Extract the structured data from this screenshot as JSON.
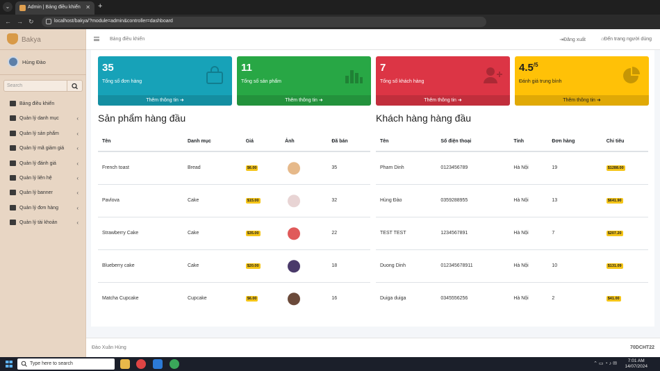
{
  "browser": {
    "tab_title": "Admin | Bảng điều khiển",
    "url": "localhost/bakya/?module=admin&controller=dashboard"
  },
  "sidebar": {
    "brand": "Bakya",
    "user_name": "Hùng Đào",
    "search_placeholder": "Search",
    "items": [
      {
        "label": "Bảng điều khiển",
        "icon": "dashboard-icon",
        "has_arrow": false
      },
      {
        "label": "Quản lý danh mục",
        "icon": "list-icon",
        "has_arrow": true
      },
      {
        "label": "Quản lý sản phẩm",
        "icon": "cake-icon",
        "has_arrow": true
      },
      {
        "label": "Quản lý mã giảm giá",
        "icon": "gift-icon",
        "has_arrow": true
      },
      {
        "label": "Quản lý đánh giá",
        "icon": "comment-icon",
        "has_arrow": true
      },
      {
        "label": "Quản lý liên hệ",
        "icon": "envelope-icon",
        "has_arrow": true
      },
      {
        "label": "Quản lý banner",
        "icon": "image-icon",
        "has_arrow": true
      },
      {
        "label": "Quản lý đơn hàng",
        "icon": "file-icon",
        "has_arrow": true
      },
      {
        "label": "Quản lý tài khoản",
        "icon": "user-icon",
        "has_arrow": true
      }
    ]
  },
  "topbar": {
    "breadcrumb": "Bảng điều khiển",
    "logout": "Đăng xuất",
    "to_user_page": "Đến trang người dùng"
  },
  "stats": [
    {
      "value": "35",
      "label": "Tổng số đơn hàng",
      "footer": "Thêm thông tin",
      "color": "#17a2b8",
      "icon": "shopping-bag-icon"
    },
    {
      "value": "11",
      "label": "Tổng số sản phẩm",
      "footer": "Thêm thông tin",
      "color": "#28a745",
      "icon": "bar-chart-icon"
    },
    {
      "value": "7",
      "label": "Tổng số khách hàng",
      "footer": "Thêm thông tin",
      "color": "#dc3545",
      "icon": "user-plus-icon"
    },
    {
      "value": "4.5",
      "suffix": "/5",
      "label": "Đánh giá trung bình",
      "footer": "Thêm thông tin",
      "color": "#ffc107",
      "icon": "pie-chart-icon"
    }
  ],
  "top_products": {
    "title": "Sản phẩm hàng đầu",
    "headers": [
      "Tên",
      "Danh mục",
      "Giá",
      "Ảnh",
      "Đã bán"
    ],
    "rows": [
      {
        "name": "French toast",
        "category": "Bread",
        "price": "$6.00",
        "sold": "35",
        "img_color": "#e6b98a"
      },
      {
        "name": "Pavlova",
        "category": "Cake",
        "price": "$15.00",
        "sold": "32",
        "img_color": "#e8d4d4"
      },
      {
        "name": "Strawberry Cake",
        "category": "Cake",
        "price": "$35.00",
        "sold": "22",
        "img_color": "#e05a5a"
      },
      {
        "name": "Blueberry cake",
        "category": "Cake",
        "price": "$20.00",
        "sold": "18",
        "img_color": "#4a3a6a"
      },
      {
        "name": "Matcha Cupcake",
        "category": "Cupcake",
        "price": "$6.00",
        "sold": "16",
        "img_color": "#6b4a3a"
      }
    ]
  },
  "top_customers": {
    "title": "Khách hàng hàng đầu",
    "headers": [
      "Tên",
      "Số điện thoại",
      "Tỉnh",
      "Đơn hàng",
      "Chi tiêu"
    ],
    "rows": [
      {
        "name": "Pham Dinh",
        "phone": "0123456789",
        "province": "Hà Nội",
        "orders": "19",
        "spent": "$1288.00"
      },
      {
        "name": "Hùng Đào",
        "phone": "0359288955",
        "province": "Hà Nội",
        "orders": "13",
        "spent": "$641.90"
      },
      {
        "name": "TEST TEST",
        "phone": "1234567891",
        "province": "Hà Nội",
        "orders": "7",
        "spent": "$207.20"
      },
      {
        "name": "Duong Dinh",
        "phone": "012345678911",
        "province": "Hà Nội",
        "orders": "10",
        "spent": "$131.09"
      },
      {
        "name": "Duiga duiga",
        "phone": "0345556256",
        "province": "Hà Nội",
        "orders": "2",
        "spent": "$41.00"
      }
    ]
  },
  "footer": {
    "left": "Đào Xuân Hùng",
    "right": "70DCHT22"
  },
  "taskbar": {
    "search_placeholder": "Type here to search",
    "time": "7:01 AM",
    "date": "14/07/2024"
  }
}
